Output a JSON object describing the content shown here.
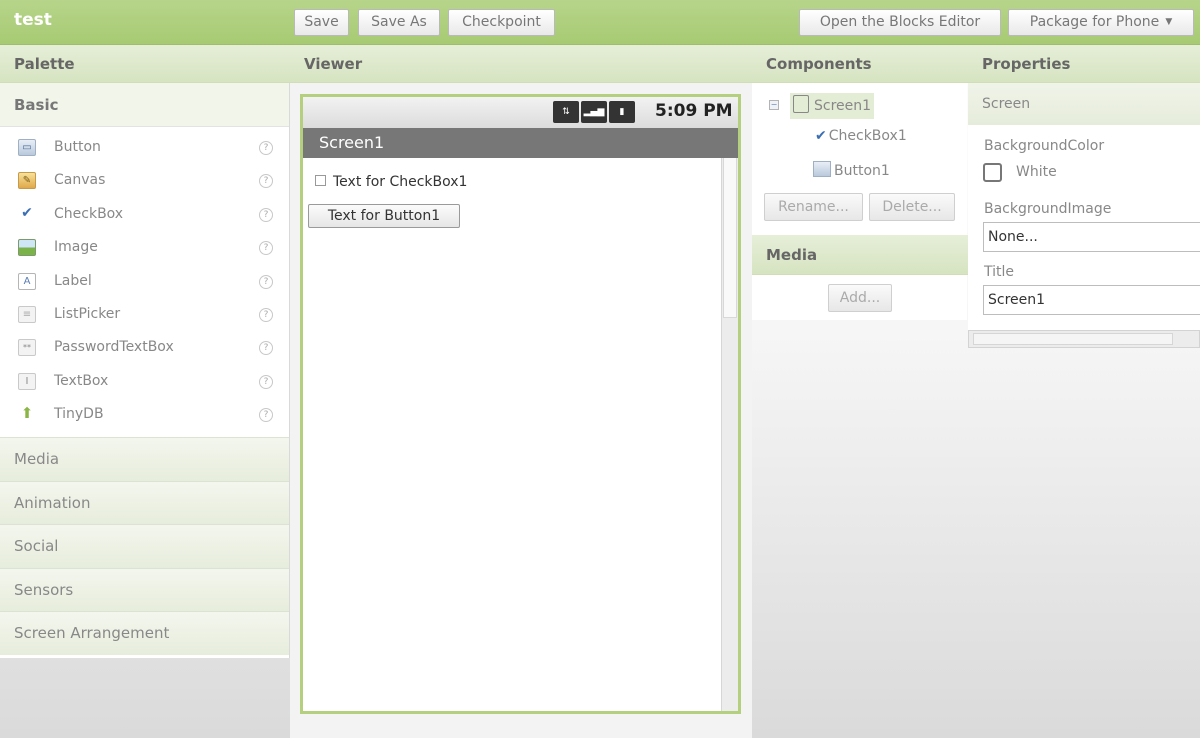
{
  "app": {
    "title": "test"
  },
  "toolbar": {
    "save": "Save",
    "save_as": "Save As",
    "checkpoint": "Checkpoint",
    "blocks_editor": "Open the Blocks Editor",
    "package": "Package for Phone"
  },
  "palette": {
    "header": "Palette",
    "open_category": "Basic",
    "items": [
      {
        "label": "Button",
        "icon": "button-icon"
      },
      {
        "label": "Canvas",
        "icon": "canvas-icon"
      },
      {
        "label": "CheckBox",
        "icon": "checkbox-icon"
      },
      {
        "label": "Image",
        "icon": "image-icon"
      },
      {
        "label": "Label",
        "icon": "label-icon"
      },
      {
        "label": "ListPicker",
        "icon": "listpicker-icon"
      },
      {
        "label": "PasswordTextBox",
        "icon": "passwordtextbox-icon"
      },
      {
        "label": "TextBox",
        "icon": "textbox-icon"
      },
      {
        "label": "TinyDB",
        "icon": "tinydb-icon"
      }
    ],
    "help_glyph": "?",
    "categories": [
      "Media",
      "Animation",
      "Social",
      "Sensors",
      "Screen Arrangement"
    ]
  },
  "viewer": {
    "header": "Viewer",
    "status_time": "5:09 PM",
    "screen_title": "Screen1",
    "checkbox_text": "Text for CheckBox1",
    "button_text": "Text for Button1"
  },
  "components": {
    "header": "Components",
    "tree": {
      "toggle": "−",
      "root": "Screen1",
      "children": [
        "CheckBox1",
        "Button1"
      ]
    },
    "rename_button": "Rename...",
    "delete_button": "Delete..."
  },
  "media": {
    "header": "Media",
    "add_button": "Add..."
  },
  "properties": {
    "header": "Properties",
    "component": "Screen",
    "background_color_label": "BackgroundColor",
    "background_color_value": "White",
    "background_image_label": "BackgroundImage",
    "background_image_value": "None...",
    "title_label": "Title",
    "title_value": "Screen1"
  },
  "colors": {
    "accent_green": "#a7ca73",
    "panel_header": "#d6e4c1",
    "phone_border": "#b4d07f"
  }
}
